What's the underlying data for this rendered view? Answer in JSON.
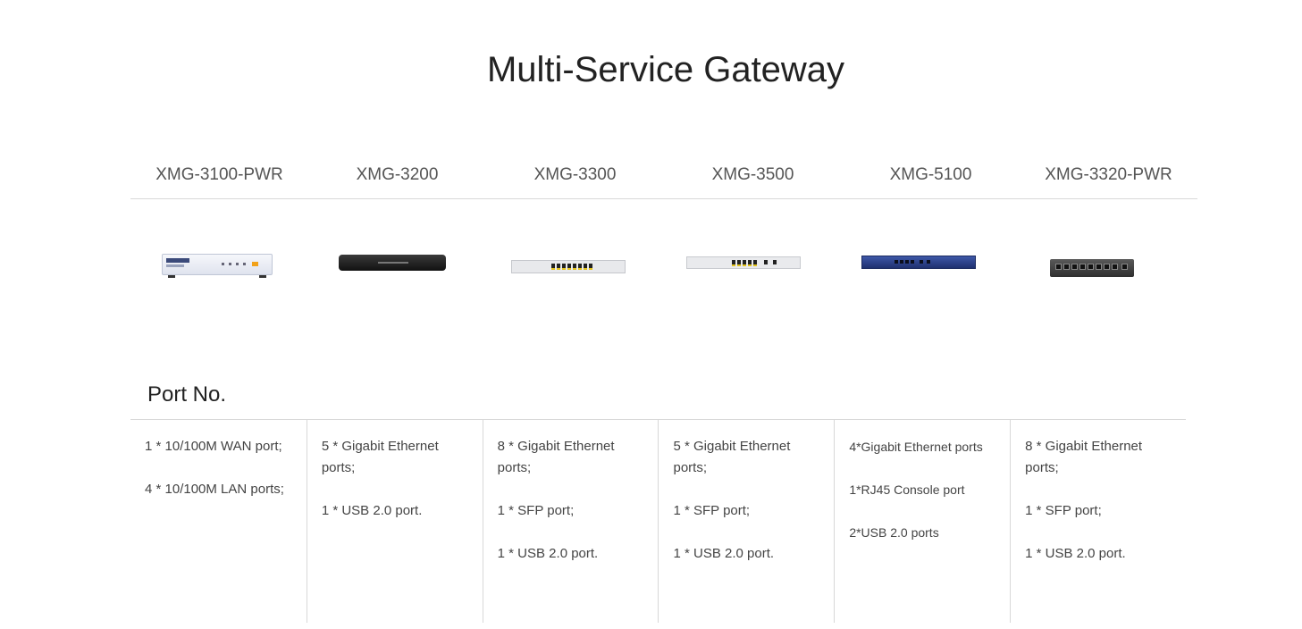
{
  "page": {
    "title": "Multi-Service Gateway"
  },
  "models": [
    "XMG-3100-PWR",
    "XMG-3200",
    "XMG-3300",
    "XMG-3500",
    "XMG-5100",
    "XMG-3320-PWR"
  ],
  "devices": [
    {
      "icon": "xmg-3100-pwr-device-image"
    },
    {
      "icon": "xmg-3200-device-image"
    },
    {
      "icon": "xmg-3300-device-image"
    },
    {
      "icon": "xmg-3500-device-image"
    },
    {
      "icon": "xmg-5100-device-image"
    },
    {
      "icon": "xmg-3320-pwr-device-image"
    }
  ],
  "ports_section": {
    "title": "Port No.",
    "columns": [
      [
        "1 * 10/100M WAN port;",
        "4 * 10/100M LAN ports;"
      ],
      [
        "5 * Gigabit Ethernet ports;",
        "1 * USB 2.0 port."
      ],
      [
        "8 * Gigabit Ethernet ports;",
        "1 * SFP port;",
        "1 * USB 2.0 port."
      ],
      [
        "5 * Gigabit Ethernet ports;",
        "1 * SFP port;",
        "1 * USB 2.0 port."
      ],
      [
        "4*Gigabit Ethernet ports",
        "1*RJ45 Console port",
        "2*USB 2.0 ports"
      ],
      [
        "8 * Gigabit Ethernet ports;",
        "1 * SFP port;",
        "1 * USB 2.0 port."
      ]
    ]
  },
  "colors": {
    "divider": "#d8d8d8",
    "text": "#444444",
    "accent_led": "#f2a21a",
    "xmg5100_blue": "#2f4590"
  }
}
